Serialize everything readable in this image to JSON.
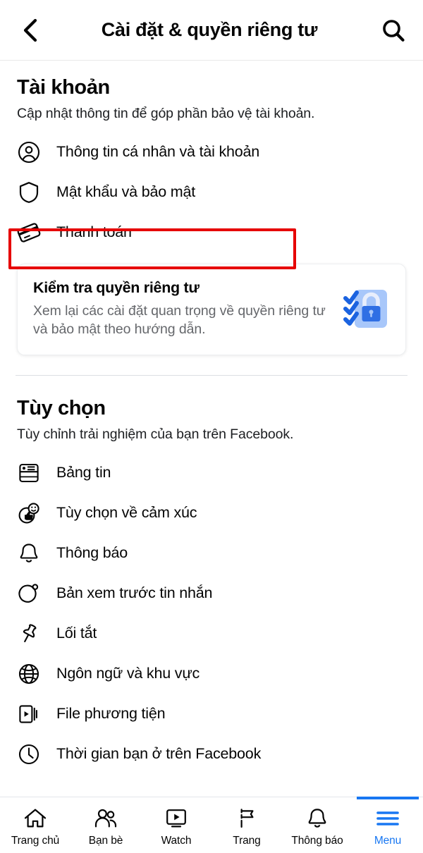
{
  "header": {
    "title": "Cài đặt & quyền riêng tư",
    "back_icon": "chevron-left-icon",
    "search_icon": "search-icon"
  },
  "sections": [
    {
      "title": "Tài khoản",
      "subtitle": "Cập nhật thông tin để góp phần bảo vệ tài khoản.",
      "items": [
        {
          "label": "Thông tin cá nhân và tài khoản",
          "icon": "person-circle-icon"
        },
        {
          "label": "Mật khẩu và bảo mật",
          "icon": "shield-icon",
          "highlighted": true
        },
        {
          "label": "Thanh toán",
          "icon": "credit-card-icon"
        }
      ]
    },
    {
      "title": "Tùy chọn",
      "subtitle": "Tùy chỉnh trải nghiệm của bạn trên Facebook.",
      "items": [
        {
          "label": "Bảng tin",
          "icon": "news-feed-icon"
        },
        {
          "label": "Tùy chọn về cảm xúc",
          "icon": "reactions-icon"
        },
        {
          "label": "Thông báo",
          "icon": "bell-icon"
        },
        {
          "label": "Bản xem trước tin nhắn",
          "icon": "message-bubble-icon"
        },
        {
          "label": "Lối tắt",
          "icon": "pin-icon"
        },
        {
          "label": "Ngôn ngữ và khu vực",
          "icon": "globe-icon"
        },
        {
          "label": "File phương tiện",
          "icon": "media-file-icon"
        },
        {
          "label": "Thời gian bạn ở trên Facebook",
          "icon": "clock-icon"
        }
      ]
    }
  ],
  "privacy_card": {
    "title": "Kiểm tra quyền riêng tư",
    "description": "Xem lại các cài đặt quan trọng về quyền riêng tư và bảo mật theo hướng dẫn.",
    "art_icon": "privacy-checkup-lock-icon"
  },
  "bottom_nav": {
    "items": [
      {
        "label": "Trang chủ",
        "icon": "home-icon",
        "active": false
      },
      {
        "label": "Bạn bè",
        "icon": "friends-icon",
        "active": false
      },
      {
        "label": "Watch",
        "icon": "watch-play-icon",
        "active": false
      },
      {
        "label": "Trang",
        "icon": "pages-flag-icon",
        "active": false
      },
      {
        "label": "Thông báo",
        "icon": "bell-icon",
        "active": false
      },
      {
        "label": "Menu",
        "icon": "hamburger-menu-icon",
        "active": true
      }
    ]
  },
  "colors": {
    "accent": "#1877f2",
    "highlight": "#e60000",
    "text": "#050505",
    "muted": "#65676b"
  }
}
